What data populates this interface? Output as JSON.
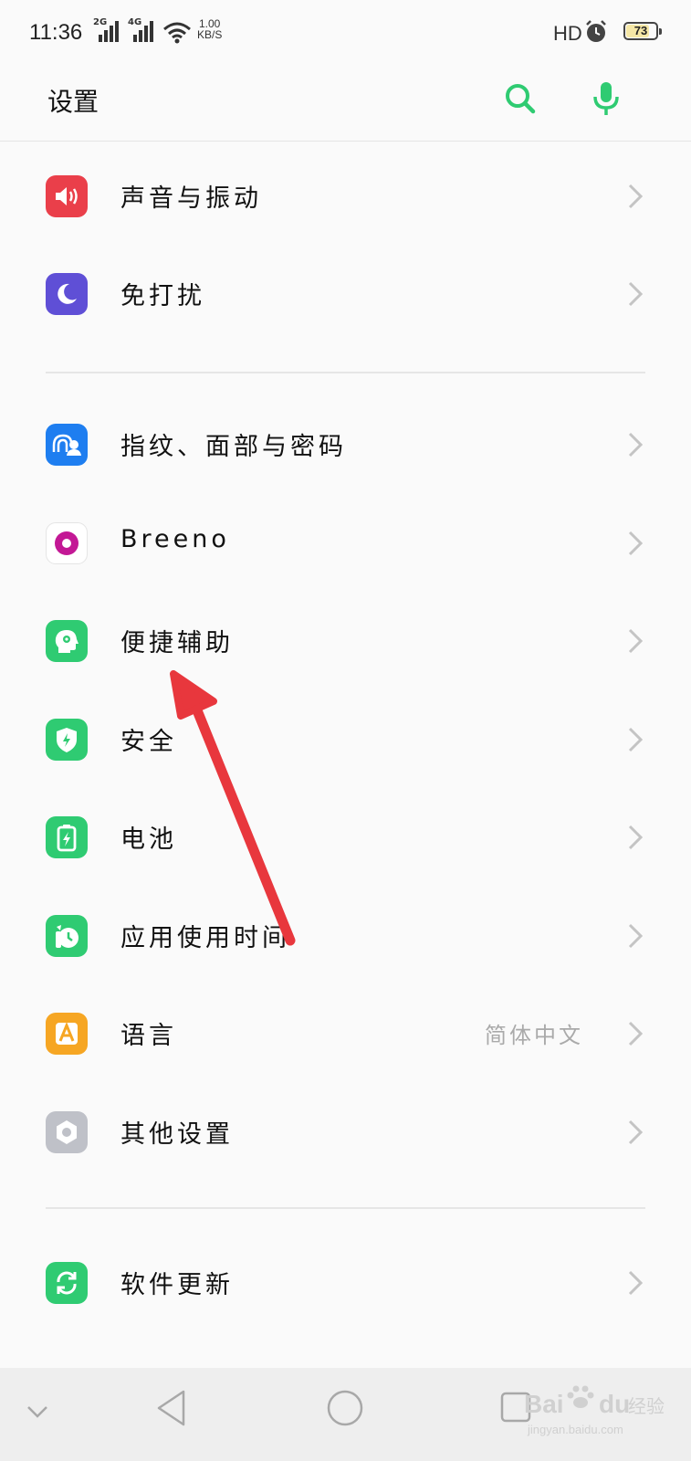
{
  "status_bar": {
    "time": "11:36",
    "network_1": "2G",
    "network_2": "4G",
    "net_speed_value": "1.00",
    "net_speed_unit": "KB/S",
    "hd_label": "HD",
    "battery_level": "73"
  },
  "header": {
    "title": "设置",
    "search_icon": "search-icon",
    "mic_icon": "microphone-icon"
  },
  "settings": {
    "items": [
      {
        "label": "声音与振动",
        "icon": "speaker-icon",
        "color": "#ea3f4a"
      },
      {
        "label": "免打扰",
        "icon": "moon-icon",
        "color": "#5f4fd6"
      },
      {
        "label": "指纹、面部与密码",
        "icon": "fingerprint-face-icon",
        "color": "#1e7ef0"
      },
      {
        "label": "Breeno",
        "icon": "breeno-icon",
        "color": "#ffffff"
      },
      {
        "label": "便捷辅助",
        "icon": "assist-head-icon",
        "color": "#2fcb72"
      },
      {
        "label": "安全",
        "icon": "shield-icon",
        "color": "#2fcb72"
      },
      {
        "label": "电池",
        "icon": "battery-icon",
        "color": "#2fcb72"
      },
      {
        "label": "应用使用时间",
        "icon": "app-time-icon",
        "color": "#2fcb72"
      },
      {
        "label": "语言",
        "value": "简体中文",
        "icon": "language-icon",
        "color": "#f6a623"
      },
      {
        "label": "其他设置",
        "icon": "hexagon-gear-icon",
        "color": "#bfc1c8"
      },
      {
        "label": "软件更新",
        "icon": "update-icon",
        "color": "#2fcb72"
      }
    ]
  },
  "nav_bar": {
    "buttons": [
      "chevron-down-icon",
      "back-icon",
      "home-icon",
      "recents-icon"
    ]
  },
  "watermark": {
    "brand": "Bai",
    "brand2": "du",
    "product": "经验",
    "url": "jingyan.baidu.com"
  },
  "annotation": {
    "arrow_color": "#e8373d"
  },
  "colors": {
    "accent": "#2fcb72"
  }
}
